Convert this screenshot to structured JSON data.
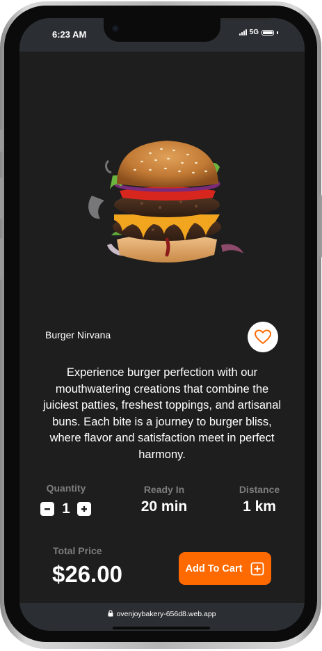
{
  "status_bar": {
    "time": "6:23 AM",
    "network": "5G"
  },
  "product": {
    "name": "Burger Nirvana",
    "description": "Experience burger perfection with our mouthwatering creations that combine the juiciest patties, freshest toppings, and artisanal buns. Each bite is a journey to burger bliss, where flavor and satisfaction meet in perfect harmony.",
    "image_icon": "burger-image",
    "favorite_icon": "heart-outline-icon"
  },
  "stats": {
    "quantity": {
      "label": "Quantity",
      "value": "1"
    },
    "ready_in": {
      "label": "Ready In",
      "value": "20 min"
    },
    "distance": {
      "label": "Distance",
      "value": "1 km"
    }
  },
  "checkout": {
    "total_label": "Total Price",
    "total_value": "$26.00",
    "add_to_cart_label": "Add To Cart",
    "add_icon": "plus-square-icon"
  },
  "browser": {
    "url": "ovenjoybakery-656d8.web.app"
  },
  "colors": {
    "background": "#1e1e1e",
    "accent": "#ff6a00",
    "muted_label": "#7d7d7d",
    "bar": "#2b2f33"
  }
}
